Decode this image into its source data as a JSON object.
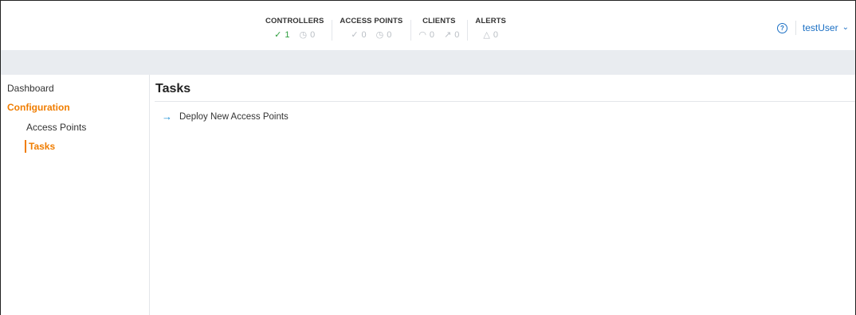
{
  "header": {
    "stats": [
      {
        "title": "CONTROLLERS",
        "values": [
          {
            "icon": "check-circle-icon",
            "glyph": "✓",
            "value": "1",
            "status": "ok"
          },
          {
            "icon": "clock-circle-icon",
            "glyph": "◷",
            "value": "0",
            "status": "muted"
          }
        ]
      },
      {
        "title": "ACCESS POINTS",
        "values": [
          {
            "icon": "check-circle-icon",
            "glyph": "✓",
            "value": "0",
            "status": "muted"
          },
          {
            "icon": "clock-circle-icon",
            "glyph": "◷",
            "value": "0",
            "status": "muted"
          }
        ]
      },
      {
        "title": "CLIENTS",
        "values": [
          {
            "icon": "wifi-icon",
            "glyph": "◠",
            "value": "0",
            "status": "muted"
          },
          {
            "icon": "wired-icon",
            "glyph": "↗",
            "value": "0",
            "status": "muted"
          }
        ]
      },
      {
        "title": "ALERTS",
        "values": [
          {
            "icon": "warning-triangle-icon",
            "glyph": "△",
            "value": "0",
            "status": "muted"
          }
        ]
      }
    ],
    "help_icon": "help-circle-icon",
    "help_glyph": "?",
    "user_name": "testUser",
    "user_chevron_icon": "chevron-down-icon",
    "user_chevron_glyph": "⌄"
  },
  "sidebar": {
    "items": [
      {
        "label": "Dashboard"
      },
      {
        "label": "Configuration"
      },
      {
        "label": "Access Points"
      },
      {
        "label": "Tasks"
      }
    ]
  },
  "main": {
    "title": "Tasks",
    "tasks": [
      {
        "icon": "arrow-right-icon",
        "glyph": "→",
        "label": "Deploy New Access Points"
      }
    ]
  },
  "colors": {
    "accent_orange": "#f07d00",
    "link_blue": "#1a6fc4",
    "ok_green": "#2e9e3e",
    "band_grey": "#e9ecf0"
  }
}
